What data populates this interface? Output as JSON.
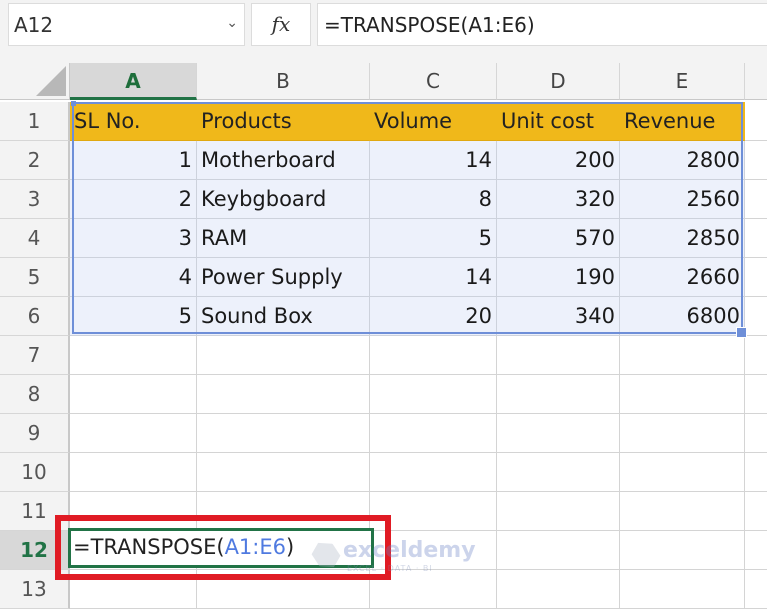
{
  "namebox": {
    "value": "A12",
    "dropdown_icon": "chevron-down-icon"
  },
  "fx_label": "fx",
  "formula_bar": {
    "value": "=TRANSPOSE(A1:E6)"
  },
  "columns": [
    "A",
    "B",
    "C",
    "D",
    "E"
  ],
  "selected_column": "A",
  "rows": [
    "1",
    "2",
    "3",
    "4",
    "5",
    "6",
    "7",
    "8",
    "9",
    "10",
    "11",
    "12",
    "13"
  ],
  "selected_row": "12",
  "table": {
    "headers": [
      "SL No.",
      "Products",
      "Volume",
      "Unit cost",
      "Revenue"
    ],
    "rows": [
      [
        "1",
        "Motherboard",
        "14",
        "200",
        "2800"
      ],
      [
        "2",
        "Keybgboard",
        "8",
        "320",
        "2560"
      ],
      [
        "3",
        "RAM",
        "5",
        "570",
        "2850"
      ],
      [
        "4",
        "Power Supply",
        "14",
        "190",
        "2660"
      ],
      [
        "5",
        "Sound Box",
        "20",
        "340",
        "6800"
      ]
    ]
  },
  "active_cell": {
    "address": "A12",
    "formula_prefix": "=TRANSPOSE(",
    "formula_ref": "A1:E6",
    "formula_suffix": ")"
  },
  "watermark": {
    "name": "exceldemy",
    "tagline": "EXCEL · DATA · BI"
  },
  "colors": {
    "header_fill": "#f0b81a",
    "data_fill": "#edf1fb",
    "selection": "#6e8fd8",
    "active_border": "#217346",
    "highlight": "#e01b24"
  }
}
